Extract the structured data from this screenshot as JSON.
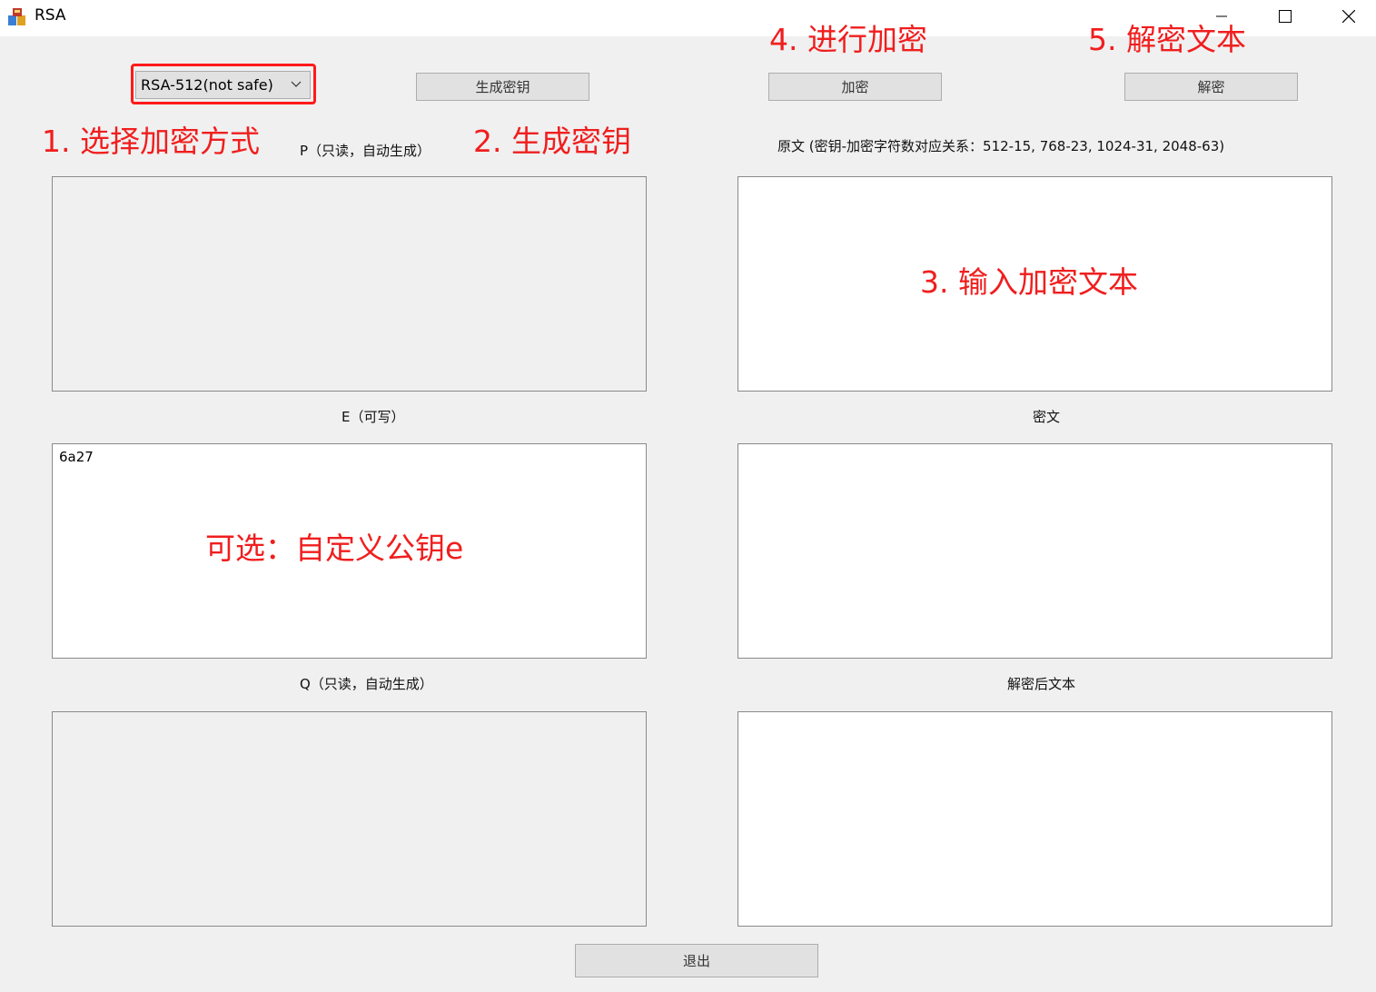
{
  "window": {
    "title": "RSA"
  },
  "toolbar": {
    "key_size_selected": "RSA-512(not safe)",
    "generate_key_label": "生成密钥",
    "encrypt_label": "加密",
    "decrypt_label": "解密",
    "exit_label": "退出"
  },
  "left_panel": {
    "p_label": "P（只读，自动生成）",
    "p_value": "",
    "e_label": "E（可写）",
    "e_value": "6a27",
    "q_label": "Q（只读，自动生成）",
    "q_value": ""
  },
  "right_panel": {
    "plaintext_label": "原文 (密钥-加密字符数对应关系：512-15, 768-23, 1024-31, 2048-63)",
    "plaintext_value": "",
    "ciphertext_label": "密文",
    "ciphertext_value": "",
    "decrypted_label": "解密后文本",
    "decrypted_value": ""
  },
  "annotations": {
    "step1": "1. 选择加密方式",
    "step2": "2. 生成密钥",
    "step3": "3. 输入加密文本",
    "step4": "4. 进行加密",
    "step5": "5. 解密文本",
    "optional": "可选：自定义公钥e"
  },
  "colors": {
    "annotation": "#f01e1e",
    "window_bg": "#f0f0f0",
    "button_bg": "#e1e1e1"
  }
}
